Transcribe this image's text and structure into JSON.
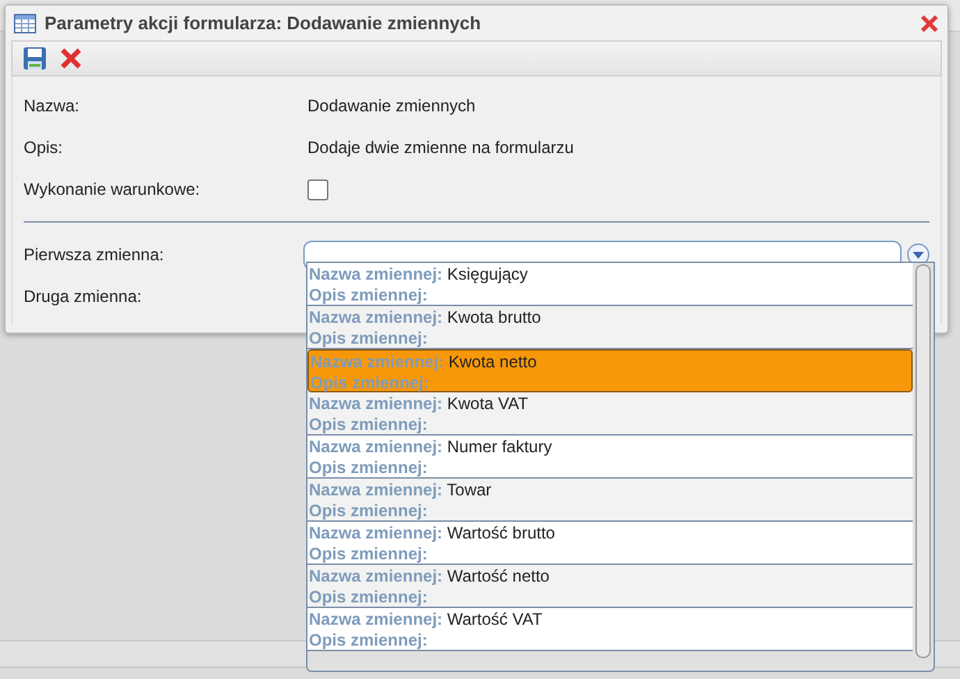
{
  "window": {
    "title": "Parametry akcji formularza: Dodawanie zmiennych"
  },
  "form": [
    {
      "kind": "text",
      "label": "Nazwa:",
      "value": "Dodawanie zmiennych"
    },
    {
      "kind": "text",
      "label": "Opis:",
      "value": "Dodaje dwie zmienne na formularzu"
    },
    {
      "kind": "checkbox",
      "label": "Wykonanie warunkowe:",
      "checked": false
    },
    {
      "kind": "divider"
    },
    {
      "kind": "combo",
      "label": "Pierwsza zmienna:"
    },
    {
      "kind": "blank",
      "label": "Druga zmienna:"
    }
  ],
  "dropdown": {
    "items": [
      {
        "name_label": "Nazwa zmiennej:",
        "name": "Księgujący",
        "desc_label": "Opis zmiennej:",
        "selected": false
      },
      {
        "name_label": "Nazwa zmiennej:",
        "name": "Kwota brutto",
        "desc_label": "Opis zmiennej:",
        "selected": false
      },
      {
        "name_label": "Nazwa zmiennej:",
        "name": "Kwota netto",
        "desc_label": "Opis zmiennej:",
        "selected": true
      },
      {
        "name_label": "Nazwa zmiennej:",
        "name": "Kwota VAT",
        "desc_label": "Opis zmiennej:",
        "selected": false
      },
      {
        "name_label": "Nazwa zmiennej:",
        "name": "Numer faktury",
        "desc_label": "Opis zmiennej:",
        "selected": false
      },
      {
        "name_label": "Nazwa zmiennej:",
        "name": "Towar",
        "desc_label": "Opis zmiennej:",
        "selected": false
      },
      {
        "name_label": "Nazwa zmiennej:",
        "name": "Wartość brutto",
        "desc_label": "Opis zmiennej:",
        "selected": false
      },
      {
        "name_label": "Nazwa zmiennej:",
        "name": "Wartość netto",
        "desc_label": "Opis zmiennej:",
        "selected": false
      },
      {
        "name_label": "Nazwa zmiennej:",
        "name": "Wartość VAT",
        "desc_label": "Opis zmiennej:",
        "selected": false
      }
    ]
  }
}
